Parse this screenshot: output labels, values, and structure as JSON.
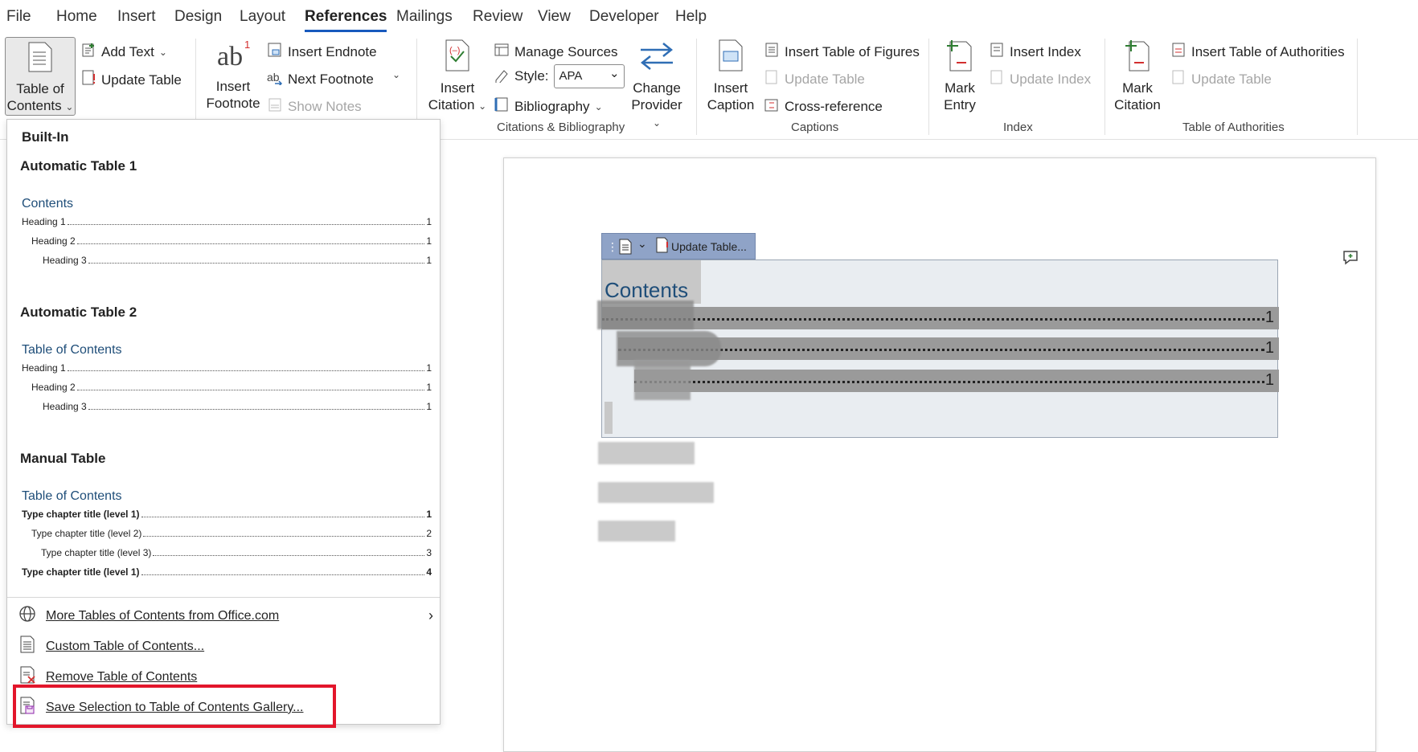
{
  "menubar": {
    "tabs": [
      "File",
      "Home",
      "Insert",
      "Design",
      "Layout",
      "References",
      "Mailings",
      "Review",
      "View",
      "Developer",
      "Help"
    ],
    "active": "References"
  },
  "ribbon": {
    "toc": {
      "label1": "Table of",
      "label2": "Contents"
    },
    "add_text": "Add Text",
    "update_table": "Update Table",
    "insert_footnote": {
      "label1": "Insert",
      "label2": "Footnote"
    },
    "insert_endnote": "Insert Endnote",
    "next_footnote": "Next Footnote",
    "show_notes": "Show Notes",
    "insert_citation": {
      "label1": "Insert",
      "label2": "Citation"
    },
    "manage_sources": "Manage Sources",
    "style_label": "Style:",
    "style_value": "APA",
    "bibliography": "Bibliography",
    "change_provider": {
      "label1": "Change",
      "label2": "Provider"
    },
    "citations_group": "Citations & Bibliography",
    "insert_caption": {
      "label1": "Insert",
      "label2": "Caption"
    },
    "insert_table_of_figures": "Insert Table of Figures",
    "update_table_captions": "Update Table",
    "cross_reference": "Cross-reference",
    "captions_group": "Captions",
    "mark_entry": {
      "label1": "Mark",
      "label2": "Entry"
    },
    "insert_index": "Insert Index",
    "update_index": "Update Index",
    "index_group": "Index",
    "mark_citation": {
      "label1": "Mark",
      "label2": "Citation"
    },
    "insert_table_of_authorities": "Insert Table of Authorities",
    "update_table_authorities": "Update Table",
    "authorities_group": "Table of Authorities"
  },
  "dropdown": {
    "builtin": "Built-In",
    "auto1": {
      "title": "Automatic Table 1",
      "contents_title": "Contents",
      "rows": [
        {
          "text": "Heading 1",
          "page": "1"
        },
        {
          "text": "Heading 2",
          "page": "1"
        },
        {
          "text": "Heading 3",
          "page": "1"
        }
      ]
    },
    "auto2": {
      "title": "Automatic Table 2",
      "contents_title": "Table of Contents",
      "rows": [
        {
          "text": "Heading 1",
          "page": "1"
        },
        {
          "text": "Heading 2",
          "page": "1"
        },
        {
          "text": "Heading 3",
          "page": "1"
        }
      ]
    },
    "manual": {
      "title": "Manual Table",
      "contents_title": "Table of Contents",
      "rows": [
        {
          "text": "Type chapter title (level 1)",
          "page": "1"
        },
        {
          "text": "Type chapter title (level 2)",
          "page": "2"
        },
        {
          "text": "Type chapter title (level 3)",
          "page": "3"
        },
        {
          "text": "Type chapter title (level 1)",
          "page": "4"
        }
      ]
    },
    "more": "More Tables of Contents from Office.com",
    "custom": "Custom Table of Contents...",
    "remove": "Remove Table of Contents",
    "save": "Save Selection to Table of Contents Gallery..."
  },
  "document": {
    "update_table": "Update Table...",
    "contents_title": "Contents",
    "rows": [
      {
        "page": "1"
      },
      {
        "page": "1"
      },
      {
        "page": "1"
      }
    ]
  }
}
